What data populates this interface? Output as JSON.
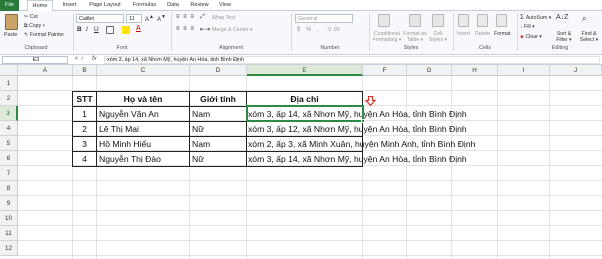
{
  "tabs": [
    "File",
    "Home",
    "Insert",
    "Page Layout",
    "Formulas",
    "Data",
    "Review",
    "View"
  ],
  "ribbon": {
    "paste": "Paste",
    "cut": "Cut",
    "copy": "Copy ▾",
    "format_painter": "Format Painter",
    "clipboard": "Clipboard",
    "font_name": "Calibri",
    "font_size": "11",
    "font_group": "Font",
    "wrap": "Wrap Text",
    "merge": "Merge & Center ▾",
    "alignment": "Alignment",
    "number_format": "General",
    "number": "Number",
    "cond_format": "Conditional Formatting ▾",
    "format_table": "Format as Table ▾",
    "cell_styles": "Cell Styles ▾",
    "styles": "Styles",
    "insert": "Insert",
    "delete": "Delete",
    "format": "Format",
    "cells": "Cells",
    "autosum": "AutoSum ▾",
    "fill": "Fill ▾",
    "clear": "Clear ▾",
    "sort": "Sort & Filter ▾",
    "find": "Find & Select ▾",
    "editing": "Editing"
  },
  "namebox": "E3",
  "formula": "xóm 3, ấp 14, xã Nhơn Mỹ, huyện An Hòa, tỉnh Bình Định",
  "columns": [
    "A",
    "B",
    "C",
    "D",
    "E",
    "F",
    "G",
    "H",
    "I",
    "J"
  ],
  "rows": [
    "1",
    "2",
    "3",
    "4",
    "5",
    "6",
    "7",
    "8",
    "9",
    "10",
    "11",
    "12"
  ],
  "selected": {
    "col": "E",
    "row": "3"
  },
  "table": {
    "headers": [
      "STT",
      "Họ và tên",
      "Giới tính",
      "Địa chỉ"
    ],
    "rows": [
      [
        "1",
        "Nguyễn Văn An",
        "Nam",
        "xóm 3, ấp 14, xã Nhơn Mỹ, huyện An Hòa, tỉnh Bình Định"
      ],
      [
        "2",
        "Lê Thị Mai",
        "Nữ",
        "xóm 3, ấp 12, xã Nhơn Mỹ, huyện An Hòa, tỉnh Bình Định"
      ],
      [
        "3",
        "Hồ Minh Hiếu",
        "Nam",
        "xóm 2, ấp 3, xã Minh Xuân, huyện Minh Anh, tỉnh Bình Định"
      ],
      [
        "4",
        "Nguyễn Thị Đào",
        "Nữ",
        "xóm 3, ấp 14, xã Nhơn Mỹ, huyện An Hòa, tỉnh Bình Định"
      ]
    ]
  },
  "colors": {
    "file_tab": "#2a7a3c",
    "selection": "#2f8a45",
    "arrow": "#d8302a"
  }
}
